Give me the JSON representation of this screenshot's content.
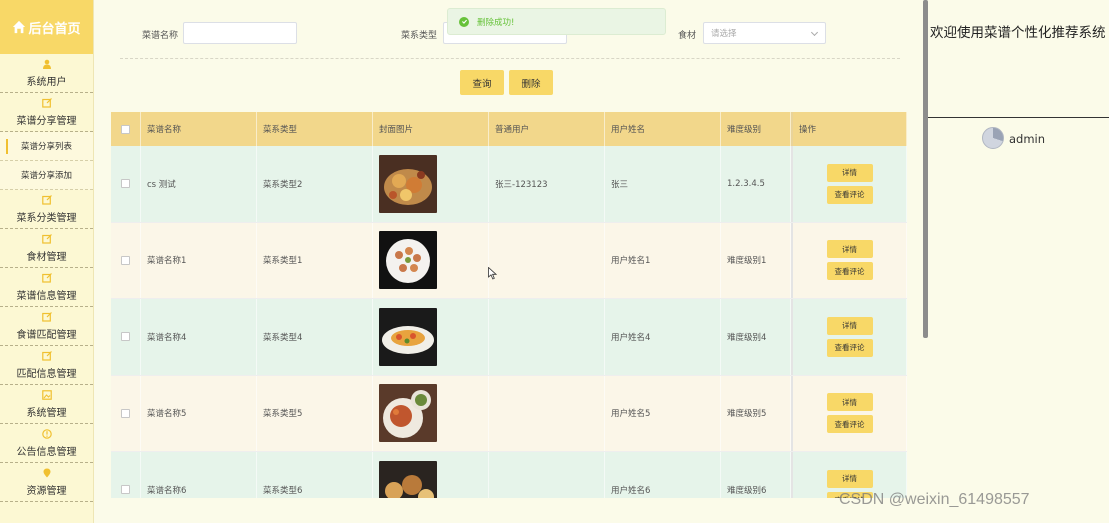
{
  "sidebar": {
    "home_label": "后台首页",
    "items": [
      {
        "label": "系统用户",
        "icon": "user-icon"
      },
      {
        "label": "菜谱分享管理",
        "icon": "edit-icon"
      },
      {
        "label": "菜系分类管理",
        "icon": "edit-icon"
      },
      {
        "label": "食材管理",
        "icon": "edit-icon"
      },
      {
        "label": "菜谱信息管理",
        "icon": "edit-icon"
      },
      {
        "label": "食谱匹配管理",
        "icon": "edit-icon"
      },
      {
        "label": "匹配信息管理",
        "icon": "edit-icon"
      },
      {
        "label": "系统管理",
        "icon": "image-icon"
      },
      {
        "label": "公告信息管理",
        "icon": "info-icon"
      },
      {
        "label": "资源管理",
        "icon": "pin-icon"
      }
    ],
    "subitems": [
      {
        "label": "菜谱分享列表",
        "active": true
      },
      {
        "label": "菜谱分享添加",
        "active": false
      }
    ]
  },
  "search": {
    "name_label": "菜谱名称",
    "name_value": "",
    "type_label": "菜系类型",
    "type_value": "",
    "ingredient_label": "食材",
    "ingredient_placeholder": "请选择",
    "query_button": "查询",
    "delete_button": "删除"
  },
  "toast": {
    "message": "删除成功!",
    "color": "#67c23a"
  },
  "table": {
    "headers": [
      "菜谱名称",
      "菜系类型",
      "封面图片",
      "普通用户",
      "用户姓名",
      "难度级别",
      "操作"
    ],
    "detail_button": "详情",
    "comment_button": "查看评论",
    "rows": [
      {
        "name": "cs 测试",
        "type": "菜系类型2",
        "user": "张三-123123",
        "username": "张三",
        "level": "1.2.3.4.5"
      },
      {
        "name": "菜谱名称1",
        "type": "菜系类型1",
        "user": "",
        "username": "用户姓名1",
        "level": "难度级别1"
      },
      {
        "name": "菜谱名称4",
        "type": "菜系类型4",
        "user": "",
        "username": "用户姓名4",
        "level": "难度级别4"
      },
      {
        "name": "菜谱名称5",
        "type": "菜系类型5",
        "user": "",
        "username": "用户姓名5",
        "level": "难度级别5"
      },
      {
        "name": "菜谱名称6",
        "type": "菜系类型6",
        "user": "",
        "username": "用户姓名6",
        "level": "难度级别6"
      }
    ]
  },
  "right_panel": {
    "welcome": "欢迎使用菜谱个性化推荐系统",
    "username": "admin"
  },
  "watermark": "CSDN @weixin_61498557",
  "colors": {
    "accent": "#f8d867",
    "header": "#f2d78b",
    "row_green": "#e6f4ea",
    "row_cream": "#fbf6e8",
    "success": "#67c23a"
  }
}
